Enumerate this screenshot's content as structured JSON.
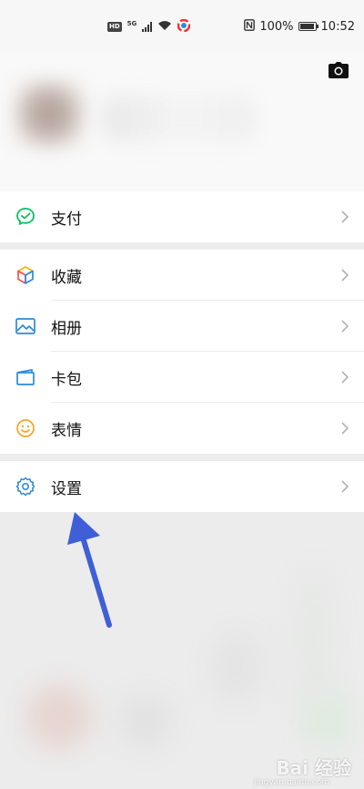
{
  "status_bar": {
    "hd_badge": "HD",
    "network": "5G",
    "nfc_icon": "nfc-icon",
    "battery_percent": "100%",
    "battery_level": 1.0,
    "time": "10:52"
  },
  "header": {
    "camera_icon": "camera-icon"
  },
  "menu": {
    "groups": [
      {
        "items": [
          {
            "label": "支付",
            "icon": "wechat-pay-icon",
            "color": "#07c160"
          }
        ]
      },
      {
        "items": [
          {
            "label": "收藏",
            "icon": "favorites-cube-icon",
            "color": "#f7b500"
          },
          {
            "label": "相册",
            "icon": "album-image-icon",
            "color": "#2b89e0"
          },
          {
            "label": "卡包",
            "icon": "card-wallet-icon",
            "color": "#2b89e0"
          },
          {
            "label": "表情",
            "icon": "emoji-smile-icon",
            "color": "#f6a623"
          }
        ]
      },
      {
        "items": [
          {
            "label": "设置",
            "icon": "settings-gear-icon",
            "color": "#2b89e0"
          }
        ]
      }
    ]
  },
  "annotation": {
    "arrow_color": "#3f5fd6"
  },
  "watermark": {
    "text": "Bai 经验",
    "sub": "jingyan.baidu.com"
  }
}
